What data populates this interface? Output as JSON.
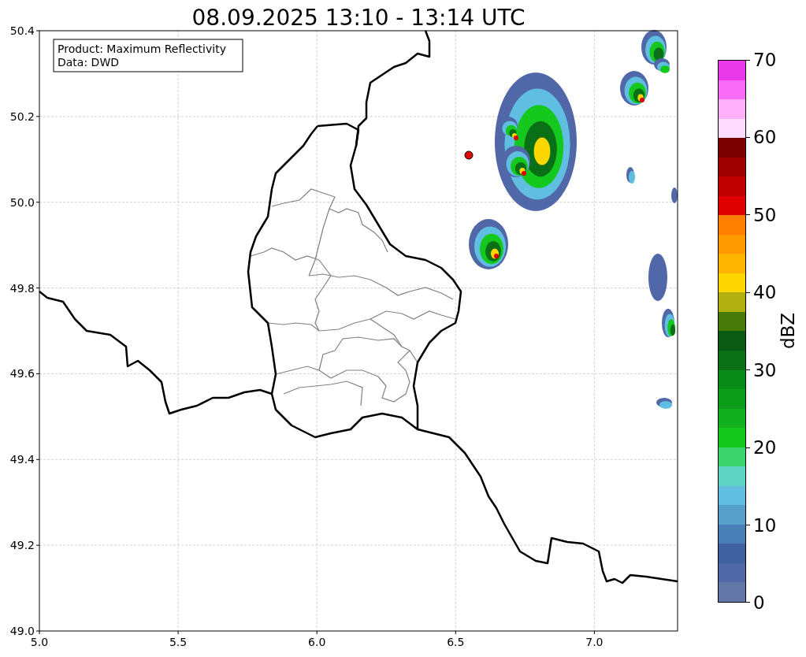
{
  "title": "08.09.2025 13:10 - 13:14 UTC",
  "map": {
    "info_box": [
      "Product: Maximum Reflectivity",
      "Data: DWD"
    ],
    "x_ticks": [
      "5.0",
      "5.5",
      "6.0",
      "6.5",
      "7.0"
    ],
    "y_ticks": [
      "50.4",
      "50.2",
      "50.0",
      "49.8",
      "49.6",
      "49.4",
      "49.2",
      "49.0"
    ]
  },
  "colorbar": {
    "label": "dBZ",
    "ticks": [
      "70",
      "60",
      "50",
      "40",
      "30",
      "20",
      "10",
      "0"
    ],
    "segments": [
      {
        "color": "#e938e8"
      },
      {
        "color": "#f86cf5"
      },
      {
        "color": "#ffb0fb"
      },
      {
        "color": "#ffdcff"
      },
      {
        "color": "#7a0000"
      },
      {
        "color": "#a00000"
      },
      {
        "color": "#c00000"
      },
      {
        "color": "#e00000"
      },
      {
        "color": "#ff7f00"
      },
      {
        "color": "#ff9a00"
      },
      {
        "color": "#ffb400"
      },
      {
        "color": "#ffd700"
      },
      {
        "color": "#b0b010"
      },
      {
        "color": "#4a7a0a"
      },
      {
        "color": "#0a5a14"
      },
      {
        "color": "#0a7016"
      },
      {
        "color": "#0a8a18"
      },
      {
        "color": "#0d9c1a"
      },
      {
        "color": "#10b01e"
      },
      {
        "color": "#14c81e"
      },
      {
        "color": "#3cd46c"
      },
      {
        "color": "#60d4c4"
      },
      {
        "color": "#60bee0"
      },
      {
        "color": "#58a0cc"
      },
      {
        "color": "#4a7eb6"
      },
      {
        "color": "#4060a0"
      },
      {
        "color": "#5068a8"
      },
      {
        "color": "#6478a8"
      }
    ]
  }
}
